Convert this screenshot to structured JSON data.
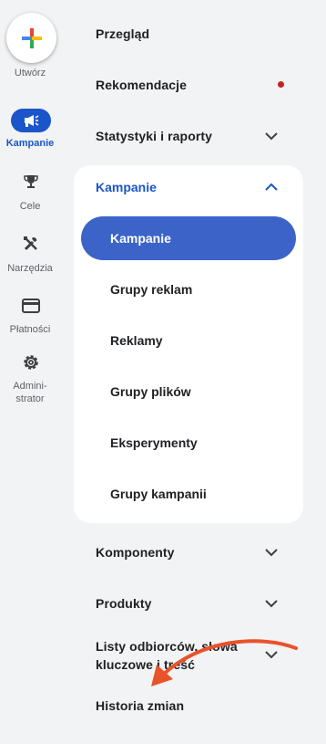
{
  "rail": {
    "create_label": "Utwórz",
    "items": [
      {
        "label": "Kampanie",
        "icon": "campaign-icon",
        "active": true
      },
      {
        "label": "Cele",
        "icon": "trophy-icon",
        "active": false
      },
      {
        "label": "Narzędzia",
        "icon": "tools-icon",
        "active": false
      },
      {
        "label": "Płatności",
        "icon": "credit-card-icon",
        "active": false
      },
      {
        "label_line1": "Admini-",
        "label_line2": "strator",
        "icon": "gear-icon",
        "active": false
      }
    ]
  },
  "nav": {
    "overview": "Przegląd",
    "recommendations": "Rekomendacje",
    "stats": "Statystyki i raporty",
    "campaigns_section": {
      "title": "Kampanie",
      "items": [
        "Kampanie",
        "Grupy reklam",
        "Reklamy",
        "Grupy plików",
        "Eksperymenty",
        "Grupy kampanii"
      ],
      "selected": "Kampanie"
    },
    "components": "Komponenty",
    "products": "Produkty",
    "audiences_line1": "Listy odbiorców, słowa",
    "audiences_line2": "kluczowe i treść",
    "history": "Historia zmian"
  },
  "colors": {
    "accent": "#1a56c9",
    "selected_pill": "#3c64c8",
    "notification_dot": "#c5221f",
    "arrow": "#e8532a",
    "background": "#f1f3f4"
  }
}
